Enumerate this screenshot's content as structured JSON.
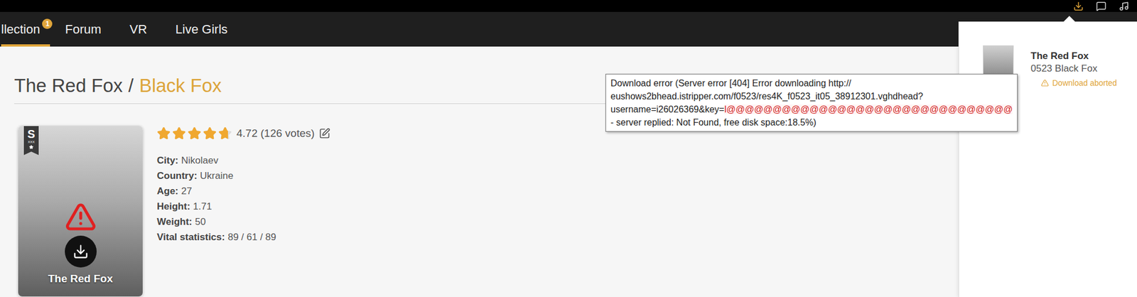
{
  "nav": {
    "items": [
      {
        "label": "llection",
        "badge": "1",
        "selected": true
      },
      {
        "label": "Forum",
        "badge": "",
        "selected": false
      },
      {
        "label": "VR",
        "badge": "",
        "selected": false
      },
      {
        "label": "Live Girls",
        "badge": "",
        "selected": false
      }
    ]
  },
  "page": {
    "title": "The Red Fox",
    "separator": "/",
    "subtitle": "Black Fox"
  },
  "card": {
    "badge": "S",
    "badge_sub": "XXX",
    "label": "The Red Fox",
    "error": true
  },
  "rating": {
    "stars": 4.72,
    "value": "4.72",
    "votes": "(126 votes)"
  },
  "details": [
    {
      "label": "City:",
      "value": "Nikolaev"
    },
    {
      "label": "Country:",
      "value": "Ukraine"
    },
    {
      "label": "Age:",
      "value": "27"
    },
    {
      "label": "Height:",
      "value": "1.71"
    },
    {
      "label": "Weight:",
      "value": "50"
    },
    {
      "label": "Vital statistics:",
      "value": "89 / 61 / 89"
    }
  ],
  "downloads": {
    "items": [
      {
        "title": "The Red Fox",
        "subtitle": "0523 Black Fox",
        "status": "Download aborted",
        "error": true
      }
    ]
  },
  "tooltip": {
    "lines": [
      [
        {
          "text": "Download error (Server error [404] Error downloading http://",
          "highlight": false
        }
      ],
      [
        {
          "text": "eushows2bhead.istripper.com/f0523/res4K_f0523_it05_38912301.vghdhead?",
          "highlight": false
        }
      ],
      [
        {
          "text": "username=i26026369&key=",
          "highlight": false
        },
        {
          "text": "l@@@@@@@@@@@@@@@@@@@@@@@@@@@@@@@",
          "highlight": true
        }
      ],
      [
        {
          "text": "- server replied: Not Found, free disk space:18.5%)",
          "highlight": false
        }
      ]
    ]
  }
}
